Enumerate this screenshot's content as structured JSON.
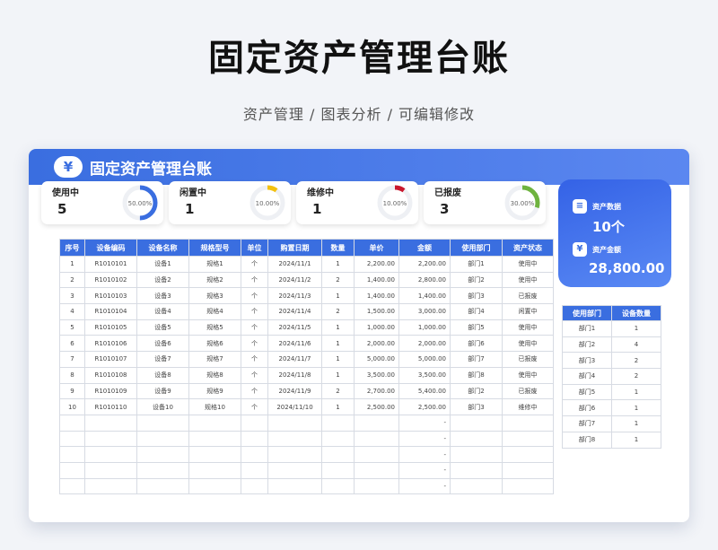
{
  "page": {
    "title": "固定资产管理台账",
    "subtitle": "资产管理 / 图表分析 / 可编辑修改"
  },
  "header": {
    "title": "固定资产管理台账",
    "icon": "yen-icon"
  },
  "stats": [
    {
      "label": "使用中",
      "value": "5",
      "percent": "50.00%",
      "fraction": 0.5,
      "color": "#3a6ee0"
    },
    {
      "label": "闲置中",
      "value": "1",
      "percent": "10.00%",
      "fraction": 0.1,
      "color": "#f3c10f"
    },
    {
      "label": "维修中",
      "value": "1",
      "percent": "10.00%",
      "fraction": 0.1,
      "color": "#c9172d"
    },
    {
      "label": "已报废",
      "value": "3",
      "percent": "30.00%",
      "fraction": 0.3,
      "color": "#6fb33f"
    }
  ],
  "summary": {
    "count_label": "资产数据",
    "count_value": "10个",
    "amount_label": "资产金额",
    "amount_value": "28,800.00"
  },
  "table": {
    "columns": [
      "序号",
      "设备编码",
      "设备名称",
      "规格型号",
      "单位",
      "购置日期",
      "数量",
      "单价",
      "金额",
      "使用部门",
      "资产状态"
    ],
    "rows": [
      [
        "1",
        "R1010101",
        "设备1",
        "规格1",
        "个",
        "2024/11/1",
        "1",
        "2,200.00",
        "2,200.00",
        "部门1",
        "使用中"
      ],
      [
        "2",
        "R1010102",
        "设备2",
        "规格2",
        "个",
        "2024/11/2",
        "2",
        "1,400.00",
        "2,800.00",
        "部门2",
        "使用中"
      ],
      [
        "3",
        "R1010103",
        "设备3",
        "规格3",
        "个",
        "2024/11/3",
        "1",
        "1,400.00",
        "1,400.00",
        "部门3",
        "已报废"
      ],
      [
        "4",
        "R1010104",
        "设备4",
        "规格4",
        "个",
        "2024/11/4",
        "2",
        "1,500.00",
        "3,000.00",
        "部门4",
        "闲置中"
      ],
      [
        "5",
        "R1010105",
        "设备5",
        "规格5",
        "个",
        "2024/11/5",
        "1",
        "1,000.00",
        "1,000.00",
        "部门5",
        "使用中"
      ],
      [
        "6",
        "R1010106",
        "设备6",
        "规格6",
        "个",
        "2024/11/6",
        "1",
        "2,000.00",
        "2,000.00",
        "部门6",
        "使用中"
      ],
      [
        "7",
        "R1010107",
        "设备7",
        "规格7",
        "个",
        "2024/11/7",
        "1",
        "5,000.00",
        "5,000.00",
        "部门7",
        "已报废"
      ],
      [
        "8",
        "R1010108",
        "设备8",
        "规格8",
        "个",
        "2024/11/8",
        "1",
        "3,500.00",
        "3,500.00",
        "部门8",
        "使用中"
      ],
      [
        "9",
        "R1010109",
        "设备9",
        "规格9",
        "个",
        "2024/11/9",
        "2",
        "2,700.00",
        "5,400.00",
        "部门2",
        "已报废"
      ],
      [
        "10",
        "R1010110",
        "设备10",
        "规格10",
        "个",
        "2024/11/10",
        "1",
        "2,500.00",
        "2,500.00",
        "部门3",
        "维修中"
      ],
      [
        "",
        "",
        "",
        "",
        "",
        "",
        "",
        "",
        "-",
        "",
        ""
      ],
      [
        "",
        "",
        "",
        "",
        "",
        "",
        "",
        "",
        "-",
        "",
        ""
      ],
      [
        "",
        "",
        "",
        "",
        "",
        "",
        "",
        "",
        "-",
        "",
        ""
      ],
      [
        "",
        "",
        "",
        "",
        "",
        "",
        "",
        "",
        "-",
        "",
        ""
      ],
      [
        "",
        "",
        "",
        "",
        "",
        "",
        "",
        "",
        "-",
        "",
        ""
      ]
    ]
  },
  "dept_table": {
    "columns": [
      "使用部门",
      "设备数量"
    ],
    "rows": [
      [
        "部门1",
        "1"
      ],
      [
        "部门2",
        "4"
      ],
      [
        "部门3",
        "2"
      ],
      [
        "部门4",
        "2"
      ],
      [
        "部门5",
        "1"
      ],
      [
        "部门6",
        "1"
      ],
      [
        "部门7",
        "1"
      ],
      [
        "部门8",
        "1"
      ]
    ]
  }
}
